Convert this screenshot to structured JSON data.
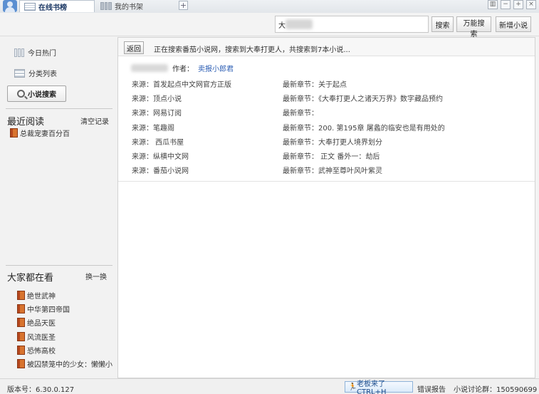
{
  "topbar": {
    "tabs": [
      {
        "label": "在线书榜"
      },
      {
        "label": "我的书架"
      }
    ],
    "add_tab": "+",
    "window_buttons": [
      "▥",
      "−",
      "+",
      "×"
    ]
  },
  "toolbar": {
    "search_value": "大",
    "search_button": "搜索",
    "wanneng_button": "万能搜索",
    "add_novel_button": "新增小说"
  },
  "sidebar": {
    "today_hot": "今日热门",
    "category_list": "分类列表",
    "novel_search": "小说搜索",
    "recent": {
      "title": "最近阅读",
      "clear": "清空记录",
      "items": [
        "总裁宠妻百分百"
      ]
    },
    "popular": {
      "title": "大家都在看",
      "refresh": "换一换",
      "items": [
        "绝世武神",
        "中华第四帝国",
        "绝品天医",
        "风流医圣",
        "恐怖高校",
        "被囚禁笼中的少女：懒懒小"
      ]
    }
  },
  "main": {
    "back_button": "返回",
    "status_text": "正在搜索番茄小说网，搜索到大奉打更人，共搜索到7本小说...",
    "author_label": "作者：",
    "author_name": "卖报小郎君",
    "results": [
      {
        "source": "来源：首发起点中文网官方正版",
        "chapter": "最新章节：关于起点"
      },
      {
        "source": "来源：顶点小说",
        "chapter": "最新章节：《大奉打更人之诸天万界》数字藏品预约"
      },
      {
        "source": "来源：网易订阅",
        "chapter": "最新章节："
      },
      {
        "source": "来源：笔趣阁",
        "chapter": "最新章节：200. 第195章 屠蠡的临安也是有用处的"
      },
      {
        "source": "来源：  西瓜书屋",
        "chapter": "最新章节：大奉打更人境界划分"
      },
      {
        "source": "来源：纵横中文网",
        "chapter": "最新章节：  正文  番外一：劫后"
      },
      {
        "source": "来源：番茄小说网",
        "chapter": "最新章节：武神至尊叶风叶紫灵"
      }
    ]
  },
  "bottombar": {
    "version": "版本号：6.30.0.127",
    "boss_key": "老板来了CTRL+H",
    "error_report": "错误报告",
    "qq_group": "小说讨论群：150590699"
  }
}
